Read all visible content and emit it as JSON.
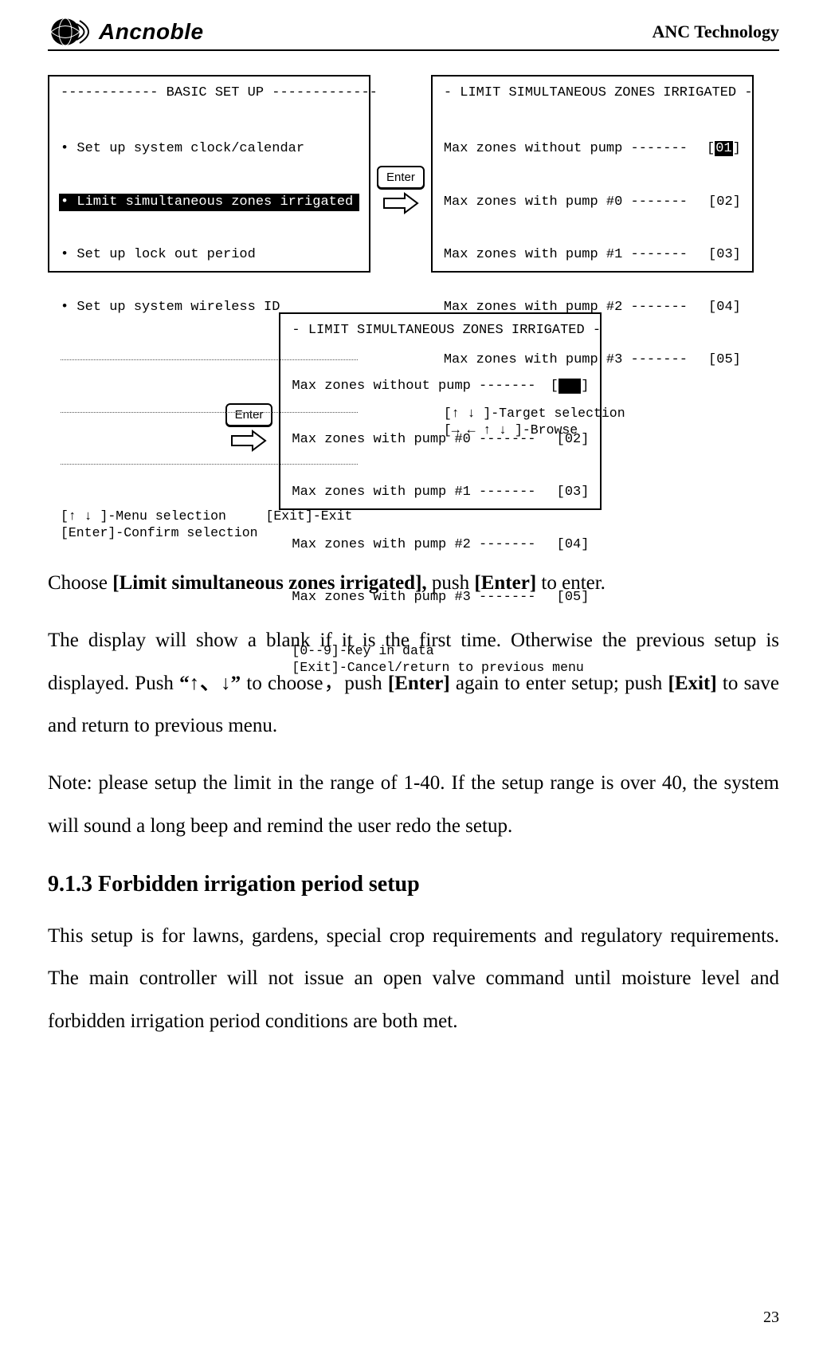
{
  "header": {
    "logo_text": "Ancnoble",
    "company": "ANC Technology"
  },
  "screens": {
    "basic_setup": {
      "title": "------------ BASIC SET UP -------------",
      "items": [
        "• Set up system clock/calendar",
        "• Limit simultaneous zones irrigated",
        "• Set up lock out period",
        "• Set up system wireless ID"
      ],
      "selected_index": 1,
      "hint1": "[↑ ↓ ]-Menu selection     [Exit]-Exit",
      "hint2": "[Enter]-Confirm selection"
    },
    "limits1": {
      "title": "- LIMIT SIMULTANEOUS ZONES IRRIGATED -",
      "rows": [
        {
          "label": "Max zones without pump -------",
          "val": "01",
          "sel": true
        },
        {
          "label": "Max zones with pump #0 -------",
          "val": "02",
          "sel": false
        },
        {
          "label": "Max zones with pump #1 -------",
          "val": "03",
          "sel": false
        },
        {
          "label": "Max zones with pump #2 -------",
          "val": "04",
          "sel": false
        },
        {
          "label": "Max zones with pump #3 -------",
          "val": "05",
          "sel": false
        }
      ],
      "hint1": "[↑ ↓ ]-Target selection",
      "hint2": "[→ ← ↑ ↓ ]-Browse"
    },
    "limits2": {
      "title": "- LIMIT SIMULTANEOUS ZONES IRRIGATED -",
      "rows": [
        {
          "label": "Max zones without pump -------",
          "val": "",
          "cursor": true
        },
        {
          "label": "Max zones with pump #0 -------",
          "val": "02"
        },
        {
          "label": "Max zones with pump #1 -------",
          "val": "03"
        },
        {
          "label": "Max zones with pump #2 -------",
          "val": "04"
        },
        {
          "label": "Max zones with pump #3 -------",
          "val": "05"
        }
      ],
      "hint1": "[0--9]-Key in data",
      "hint2": "[Exit]-Cancel/return to previous menu"
    },
    "enter_label": "Enter"
  },
  "body": {
    "p1_a": "Choose ",
    "p1_b": "[Limit simultaneous zones irrigated],",
    "p1_c": " push ",
    "p1_d": "[Enter]",
    "p1_e": " to enter.",
    "p2_a": "The display will show a blank if it is the first time. Otherwise the previous setup is displayed. Push ",
    "p2_b": "“↑、↓”",
    "p2_c": " to choose，push ",
    "p2_d": "[Enter]",
    "p2_e": " again to enter setup; push ",
    "p2_f": "[Exit]",
    "p2_g": " to save and return to previous menu.",
    "p3": "Note: please setup the limit in the range of 1-40. If the setup range is over 40, the system will sound a long beep and remind the user redo the setup.",
    "h3": "9.1.3 Forbidden irrigation period setup",
    "p4": "This setup is for lawns, gardens, special crop requirements and regulatory requirements. The main controller will not issue an open valve command until moisture level and forbidden irrigation period conditions are both met."
  },
  "page_number": "23"
}
